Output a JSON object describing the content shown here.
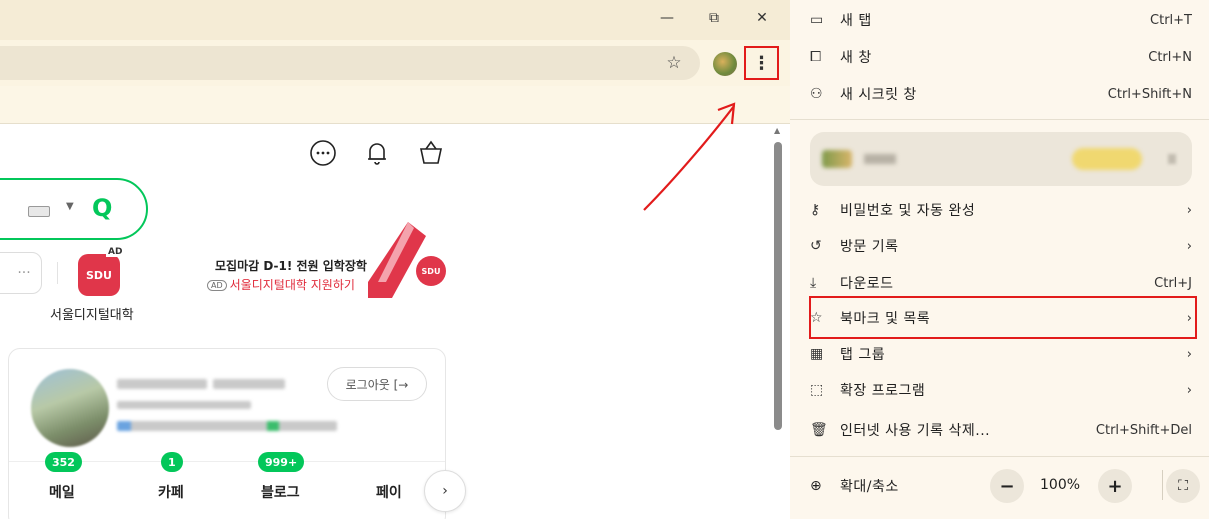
{
  "window": {
    "minimize_icon": "minimize-icon",
    "restore_icon": "restore-icon",
    "close_icon": "close-icon",
    "minimize_glyph": "—",
    "restore_glyph": "⧉",
    "close_glyph": "✕"
  },
  "toolbar": {
    "bookmark_star_glyph": "☆",
    "menu_glyph": "⋮"
  },
  "page": {
    "top_icons": [
      "chat-icon",
      "bell-icon",
      "shopping-bag-icon"
    ],
    "search": {
      "go_glyph": "Q"
    },
    "more_label": "···",
    "sdu_tile_label": "SDU",
    "ad_badge": "AD",
    "sdu_label": "서울디지털대학",
    "banner": {
      "line1": "모집마감 D-1! 전원 입학장학",
      "ad": "AD",
      "line2": "서울디지털대학 지원하기",
      "logo": "SDU"
    },
    "user_card": {
      "logout_label": "로그아웃 [→",
      "services": [
        {
          "label": "메일",
          "count": "352"
        },
        {
          "label": "카페",
          "count": "1"
        },
        {
          "label": "블로그",
          "count": "999+"
        },
        {
          "label": "페이",
          "count": ""
        }
      ],
      "next_glyph": "›"
    }
  },
  "menu": {
    "items_top": [
      {
        "icon": "new-tab-icon",
        "glyph": "▭",
        "label": "새 탭",
        "shortcut": "Ctrl+T"
      },
      {
        "icon": "new-window-icon",
        "glyph": "⧠",
        "label": "새 창",
        "shortcut": "Ctrl+N"
      },
      {
        "icon": "incognito-icon",
        "glyph": "⚇",
        "label": "새 시크릿 창",
        "shortcut": "Ctrl+Shift+N"
      }
    ],
    "items_mid": [
      {
        "icon": "key-icon",
        "glyph": "⚷",
        "label": "비밀번호 및 자동 완성",
        "right": "›"
      },
      {
        "icon": "history-icon",
        "glyph": "↺",
        "label": "방문 기록",
        "right": "›"
      },
      {
        "icon": "download-icon",
        "glyph": "⤓",
        "label": "다운로드",
        "right": "Ctrl+J"
      },
      {
        "icon": "star-icon",
        "glyph": "☆",
        "label": "북마크 및 목록",
        "right": "›"
      },
      {
        "icon": "tab-groups-icon",
        "glyph": "▦",
        "label": "탭 그룹",
        "right": "›"
      },
      {
        "icon": "extension-icon",
        "glyph": "⬚",
        "label": "확장 프로그램",
        "right": "›"
      },
      {
        "icon": "trash-icon",
        "glyph": "🗑",
        "label": "인터넷 사용 기록 삭제...",
        "right": "Ctrl+Shift+Del"
      }
    ],
    "zoom": {
      "icon": "zoom-icon",
      "glyph": "⊕",
      "label": "확대/축소",
      "minus": "−",
      "value": "100%",
      "plus": "+",
      "fullscreen_glyph": "⛶"
    }
  },
  "colors": {
    "highlight": "#e21b1b",
    "naver_green": "#03c75a",
    "sdu_red": "#e0364a"
  }
}
